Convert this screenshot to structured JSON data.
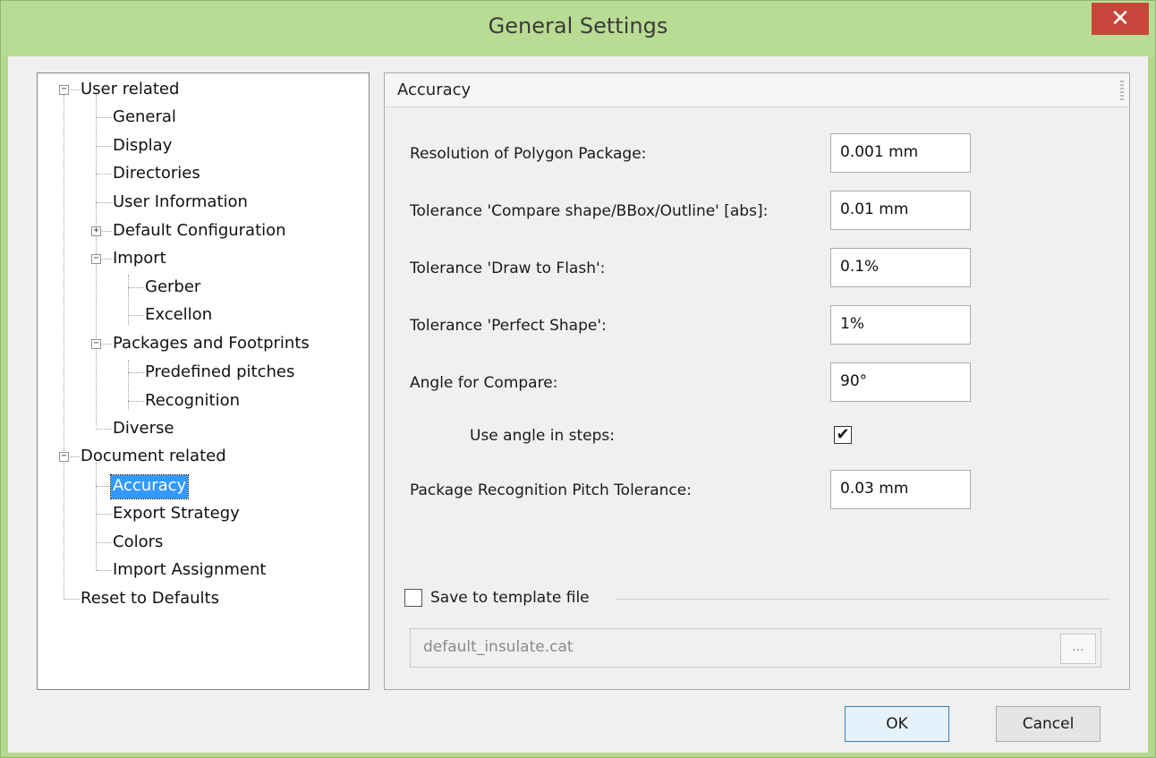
{
  "window": {
    "title": "General Settings",
    "close_glyph": "✕"
  },
  "tree": {
    "nodes": [
      {
        "label": "User related",
        "expander": "−"
      },
      {
        "label": "General"
      },
      {
        "label": "Display"
      },
      {
        "label": "Directories"
      },
      {
        "label": "User Information"
      },
      {
        "label": "Default Configuration",
        "expander": "+"
      },
      {
        "label": "Import",
        "expander": "−"
      },
      {
        "label": "Gerber"
      },
      {
        "label": "Excellon"
      },
      {
        "label": "Packages and Footprints",
        "expander": "−"
      },
      {
        "label": "Predefined pitches"
      },
      {
        "label": "Recognition"
      },
      {
        "label": "Diverse"
      },
      {
        "label": "Document related",
        "expander": "−"
      },
      {
        "label": "Accuracy",
        "selected": true
      },
      {
        "label": "Export Strategy"
      },
      {
        "label": "Colors"
      },
      {
        "label": "Import Assignment"
      },
      {
        "label": "Reset to Defaults"
      }
    ]
  },
  "panel": {
    "title": "Accuracy",
    "fields": [
      {
        "label": "Resolution of Polygon Package:",
        "value": "0.001 mm"
      },
      {
        "label": "Tolerance 'Compare shape/BBox/Outline' [abs]:",
        "value": "0.01 mm"
      },
      {
        "label": "Tolerance 'Draw to Flash':",
        "value": "0.1%"
      },
      {
        "label": "Tolerance 'Perfect Shape':",
        "value": "1%"
      },
      {
        "label": "Angle for Compare:",
        "value": "90°"
      },
      {
        "label": "Use angle in steps:",
        "checked": true,
        "check_glyph": "✔"
      },
      {
        "label": "Package Recognition Pitch Tolerance:",
        "value": "0.03 mm"
      }
    ],
    "template": {
      "label": "Save to template file",
      "checked": false,
      "filename": "default_insulate.cat",
      "browse_label": "..."
    }
  },
  "buttons": {
    "ok": "OK",
    "cancel": "Cancel"
  }
}
